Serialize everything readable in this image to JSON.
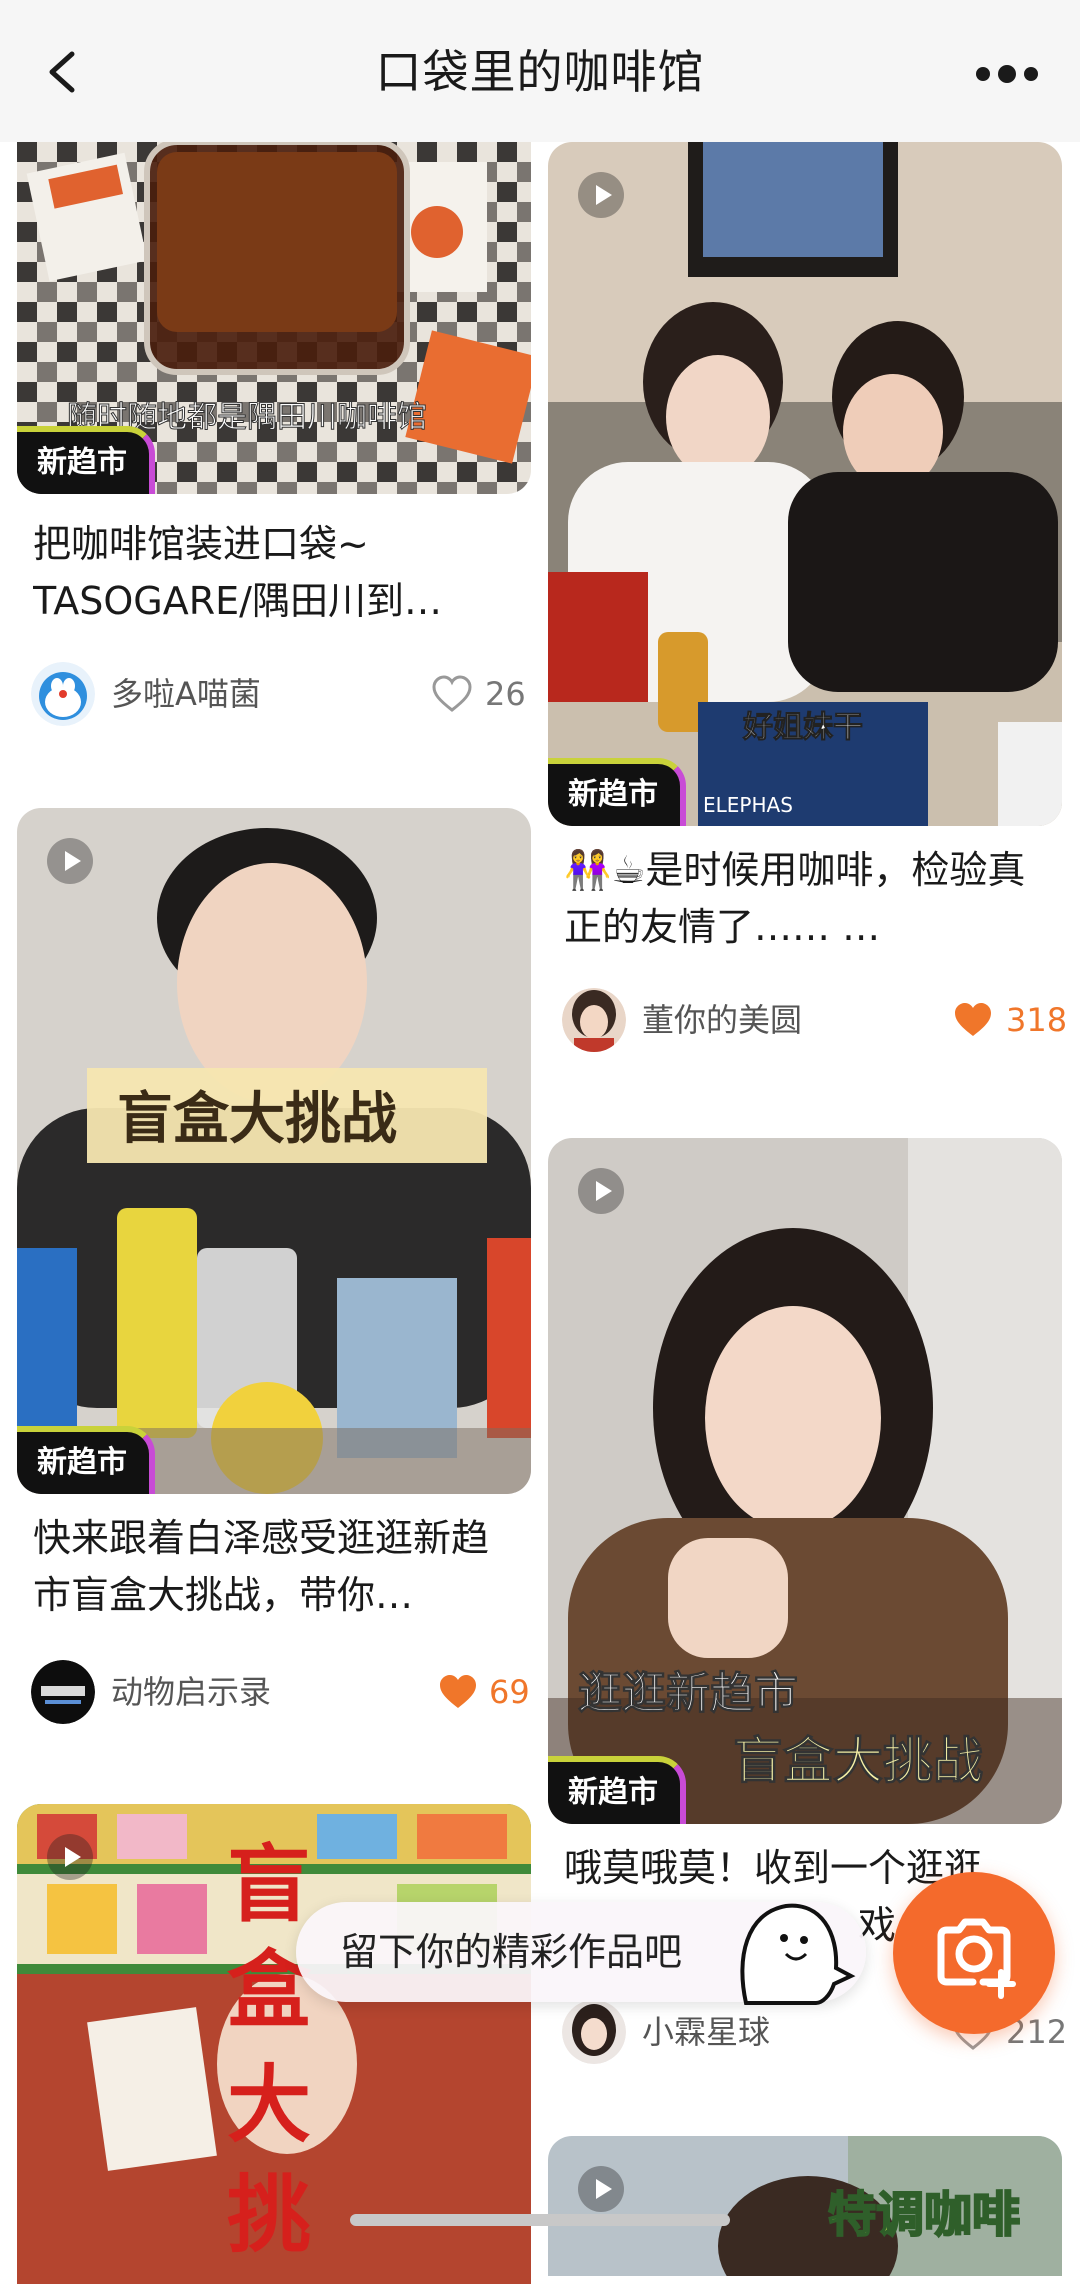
{
  "header": {
    "title": "口袋里的咖啡馆"
  },
  "colors": {
    "accent_orange": "#f46a2c",
    "like_orange": "#f0762a",
    "badge_bg": "#111111"
  },
  "cards": [
    {
      "badge": "新趋市",
      "overlay_text": "随时随地都是隅田川咖啡馆",
      "title": "把咖啡馆装进口袋~ TASOGARE/隅田川到…",
      "author": "多啦A喵菌",
      "likes": "26",
      "liked": false,
      "video": false
    },
    {
      "badge": "新趋市",
      "overlay_text": "好姐妹干",
      "title": "👭☕是时候用咖啡，检验真正的友情了……  …",
      "author": "董你的美圆",
      "likes": "318",
      "liked": true,
      "video": true
    },
    {
      "badge": "新趋市",
      "overlay_text": "盲盒大挑战",
      "title": "快来跟着白泽感受逛逛新趋市盲盒大挑战，带你…",
      "author": "动物启示录",
      "likes": "69",
      "liked": true,
      "video": true
    },
    {
      "badge": "新趋市",
      "overlay_text_1": "逛逛新趋市",
      "overlay_text_2": "盲盒大挑战",
      "title": "哦莫哦莫！收到一个逛逛",
      "title_line2": "戏",
      "author": "小霖星球",
      "likes": "212",
      "liked": false,
      "video": true
    },
    {
      "overlay_text": "盲盒大挑",
      "video": true
    },
    {
      "overlay_text": "特调咖啡",
      "video": true
    }
  ],
  "floating": {
    "prompt": "留下你的精彩作品吧",
    "camera_icon": "camera-plus-icon",
    "mascot_icon": "mascot-icon"
  }
}
